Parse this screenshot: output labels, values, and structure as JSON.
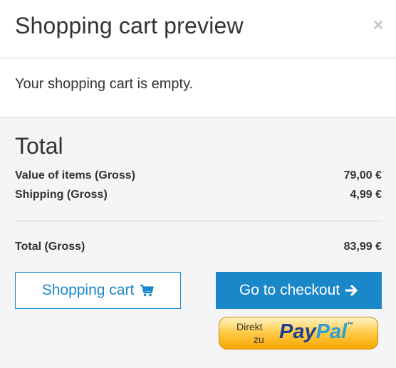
{
  "modal": {
    "title": "Shopping cart preview",
    "close_symbol": "×"
  },
  "cart": {
    "empty_message": "Your shopping cart is empty."
  },
  "summary": {
    "heading": "Total",
    "value_items_label": "Value of items (Gross)",
    "value_items_value": "79,00 €",
    "shipping_label": "Shipping (Gross)",
    "shipping_value": "4,99 €",
    "total_label": "Total (Gross)",
    "total_value": "83,99 €"
  },
  "actions": {
    "shopping_cart_label": "Shopping cart",
    "shopping_cart_icon": "cart-icon",
    "checkout_label": "Go to checkout",
    "checkout_icon": "arrow-right-icon"
  },
  "paypal": {
    "direkt": "Direkt",
    "zu": "zu",
    "pay": "Pay",
    "pal": "Pal",
    "tm": "™"
  },
  "colors": {
    "accent": "#1a87c9",
    "footer_bg": "#f5f5f7",
    "paypal_dark": "#1c3f94",
    "paypal_light": "#2a9fd8"
  }
}
